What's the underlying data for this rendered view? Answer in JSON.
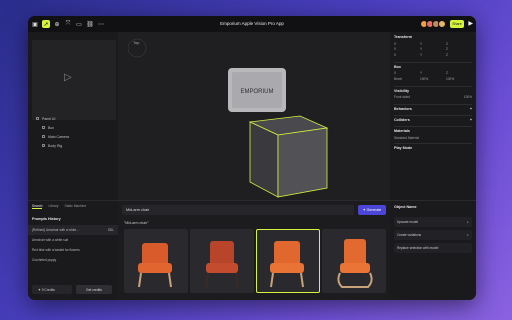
{
  "app": {
    "title": "Emporium Apple Vision Pro App",
    "share_label": "Share"
  },
  "colors": {
    "accent": "#d4f53c",
    "generate": "#4c46d8",
    "avatars": [
      "#f0a040",
      "#e86d6d",
      "#c08a5a",
      "#e9b46a"
    ]
  },
  "toolbar": {
    "icons": [
      "cube-icon",
      "cursor-icon",
      "plus-circle-icon",
      "transform-icon",
      "chat-icon",
      "link-icon",
      "more-icon"
    ]
  },
  "viewport": {
    "view_label": "Top",
    "sign_text": "EMPORIUM"
  },
  "outline": {
    "items": [
      {
        "label": "Panel UI",
        "child": false
      },
      {
        "label": "Box",
        "child": true
      },
      {
        "label": "Main Camera",
        "child": true
      },
      {
        "label": "Body Rig",
        "child": true
      }
    ]
  },
  "inspector": {
    "transform": {
      "title": "Transform",
      "rows": [
        [
          "X",
          "Y",
          "Z"
        ],
        [
          "X",
          "Y",
          "Z"
        ],
        [
          "X",
          "Y",
          "Z"
        ]
      ]
    },
    "box": {
      "title": "Box",
      "size_rows": [
        [
          "X",
          "Y",
          "Z"
        ]
      ],
      "bevel_label": "Bevel",
      "bevel_values": [
        "100%",
        "100%"
      ]
    },
    "visibility": {
      "title": "Visibility",
      "value": "Front sided",
      "opacity": "100%"
    },
    "behaviors": "Behaviors",
    "colliders": "Colliders",
    "materials": {
      "title": "Materials",
      "item": "Standard Material"
    },
    "play_mode": "Play Mode"
  },
  "bottom_tabs": {
    "items": [
      "Search",
      "Library",
      "Static Machine"
    ]
  },
  "prompt_history": {
    "title": "Prompts History",
    "items": [
      {
        "text": "(Refined) Armchair with a white...",
        "meta": "SDL"
      },
      {
        "text": "Armchair with a white suit",
        "meta": ""
      },
      {
        "text": "Red bike with a basket for flowers",
        "meta": ""
      },
      {
        "text": "Crocheted puppy",
        "meta": ""
      }
    ],
    "credits": "9 Credits",
    "get_more": "Get credits"
  },
  "search": {
    "query": "Mid-arm chair",
    "generate_label": "Generate",
    "result_label": "\"Mid-arm chair\""
  },
  "object_name": {
    "title": "Object Name",
    "actions": [
      "Upscale model",
      "Create variations",
      "Replace selection with model"
    ]
  }
}
